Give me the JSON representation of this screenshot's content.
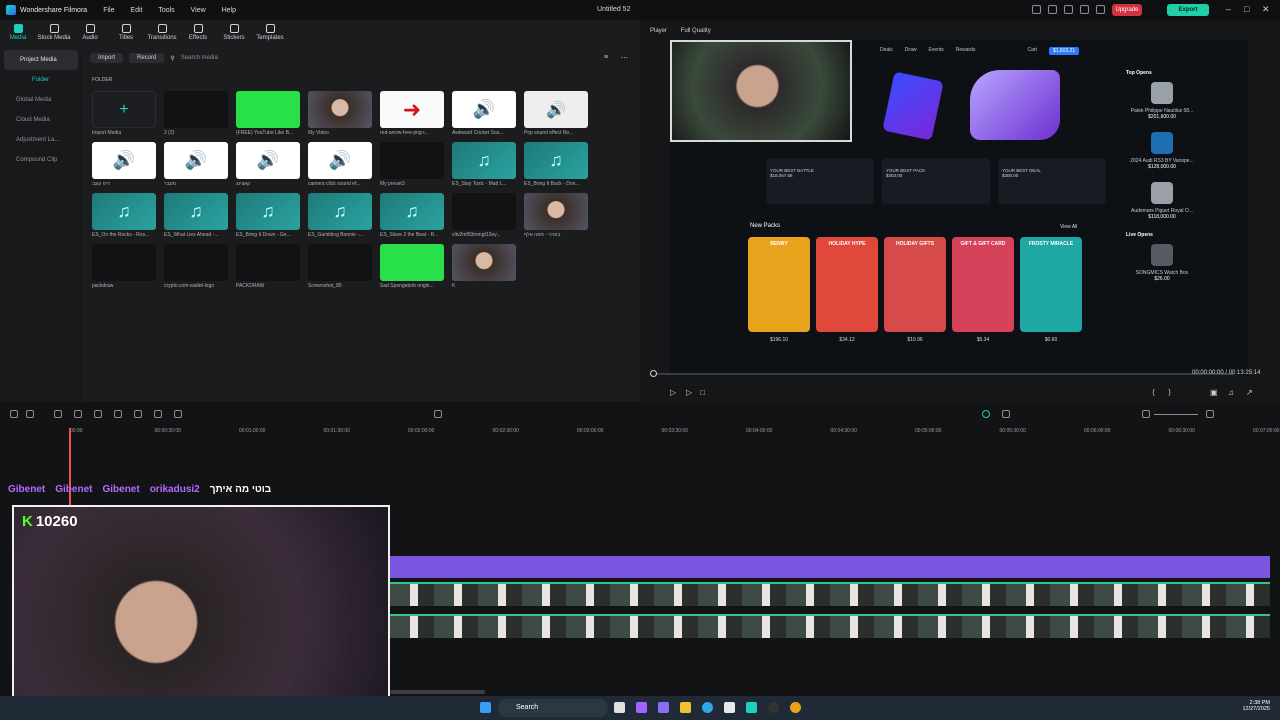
{
  "app": {
    "title": "Wondershare Filmora",
    "document": "Untitled 52"
  },
  "menu": [
    "File",
    "Edit",
    "Tools",
    "View",
    "Help"
  ],
  "top_buttons": {
    "upgrade": "Upgrade",
    "export": "Export"
  },
  "tabs": [
    "Media",
    "Stock Media",
    "Audio",
    "Titles",
    "Transitions",
    "Effects",
    "Stickers",
    "Templates"
  ],
  "sidebar": {
    "items": [
      "Project Media",
      "Folder",
      "Global Media",
      "Cloud Media",
      "Adjustment La...",
      "Compound Clip"
    ]
  },
  "media_toolbar": {
    "import": "Import",
    "record": "Record",
    "search_placeholder": "Search media"
  },
  "folder_label": "FOLDER",
  "media": [
    {
      "caption": "Import Media",
      "kind": "import",
      "icon": "plus-icon"
    },
    {
      "caption": "2 (2)",
      "kind": "dark"
    },
    {
      "caption": "(FREE) YouTube Like B...",
      "kind": "green"
    },
    {
      "caption": "My Video",
      "kind": "face"
    },
    {
      "caption": "red-arrow-free-png-i...",
      "kind": "red"
    },
    {
      "caption": "Awkward Cricket Sou...",
      "kind": "speaker"
    },
    {
      "caption": "Pop sound effect No...",
      "kind": "purple"
    },
    {
      "caption": "דיפ עוגב",
      "kind": "speaker"
    },
    {
      "caption": "מעבר",
      "kind": "speaker"
    },
    {
      "caption": "קאצינג",
      "kind": "speaker"
    },
    {
      "caption": "camera click sound ef...",
      "kind": "speaker"
    },
    {
      "caption": "My preset3",
      "kind": "dark"
    },
    {
      "caption": "ES_Stay Toxic - Matt L...",
      "kind": "music"
    },
    {
      "caption": "ES_Bring It Back - Don...",
      "kind": "music"
    },
    {
      "caption": "ES_On the Rocks - Ros...",
      "kind": "music"
    },
    {
      "caption": "ES_What Lies Ahead -...",
      "kind": "music"
    },
    {
      "caption": "ES_Bring It Down - Ge...",
      "kind": "music"
    },
    {
      "caption": "ES_Gambling Bonnie -...",
      "kind": "music"
    },
    {
      "caption": "ES_Slave 2 the Beat - R...",
      "kind": "music"
    },
    {
      "caption": "cltv2mf93mmgt13ey...",
      "kind": "dark"
    },
    {
      "caption": "בוטיני - מאה אלף",
      "kind": "face"
    },
    {
      "caption": "packdraw",
      "kind": "dark"
    },
    {
      "caption": "crypto.com-wallet-logo",
      "kind": "dark"
    },
    {
      "caption": "PACKDRAW",
      "kind": "dark"
    },
    {
      "caption": "Screenshot_85",
      "kind": "dark"
    },
    {
      "caption": "Sad Spongebob origin...",
      "kind": "green"
    },
    {
      "caption": "K",
      "kind": "face"
    }
  ],
  "player": {
    "label": "Player",
    "quality": "Full Quality",
    "timecode_current": "00:00:00:00",
    "timecode_total": "/ 00:13:25:14"
  },
  "site": {
    "nav": [
      "Deals",
      "Draw",
      "Events",
      "Rewards",
      "Cart",
      "$1,603.21"
    ],
    "top_opens": "Top Opens",
    "top_open_items": [
      {
        "name": "Patek Philippe Nautilus 58...",
        "price": "$201,600.00"
      },
      {
        "name": "2024 Audi RS3 BY Vanspe...",
        "price": "$128,000.00"
      },
      {
        "name": "Audemars Piguet Royal O...",
        "price": "$118,000.00"
      }
    ],
    "live_opens": "Live Opens",
    "live_item": {
      "name": "SONGMICS Watch Box",
      "price": "$26.00"
    },
    "deals": [
      "YOUR BEST BATTLE",
      "YOUR BEST PACK",
      "YOUR BEST DEAL"
    ],
    "deal_values": [
      "$18,067.66",
      "$303.00",
      "$300.00"
    ],
    "new_packs": "New Packs",
    "view_all": "View All",
    "packs": [
      {
        "name": "BENNY",
        "price": "$196.10",
        "color": "#e9a21c"
      },
      {
        "name": "HOLIDAY HYPE",
        "price": "$34.12",
        "color": "#e0483c"
      },
      {
        "name": "HOLIDAY GIFTS",
        "price": "$10.96",
        "color": "#d64a4a"
      },
      {
        "name": "GIFT & GIFT CARD",
        "price": "$5.34",
        "color": "#d6425a"
      },
      {
        "name": "FROSTY MIRACLE",
        "price": "$0.60",
        "color": "#1fa7a4"
      }
    ]
  },
  "ruler": [
    "00:00",
    "00:00:30:00",
    "00:01:00:00",
    "00:01:30:00",
    "00:02:00:00",
    "00:02:30:00",
    "00:03:00:00",
    "00:03:30:00",
    "00:04:00:00",
    "00:04:30:00",
    "00:05:00:00",
    "00:05:30:00",
    "00:06:00:00",
    "00:06:30:00",
    "00:07:00:00"
  ],
  "chat": {
    "users": [
      "Gibenet",
      "Gibenet",
      "Gibenet",
      "orikadusi2"
    ],
    "message": "בוטי מה איתך"
  },
  "stream": {
    "kick_count": "10260",
    "kick_logo": "K"
  },
  "taskbar": {
    "search": "Search",
    "time": "2:38 PM",
    "date": "12/27/2025"
  }
}
